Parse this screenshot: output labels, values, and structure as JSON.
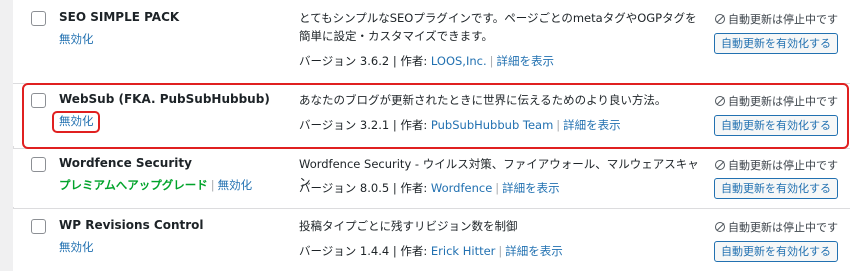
{
  "plugins": [
    {
      "name": "SEO SIMPLE PACK",
      "upgrade_label": "",
      "deactivate_label": "無効化",
      "description": "とてもシンプルなSEOプラグインです。ページごとのmetaタグやOGPタグを簡単に設定・カスタマイズできます。",
      "version_text": "バージョン 3.6.2 | 作者: ",
      "author": "LOOS,Inc.",
      "details_label": "詳細を表示",
      "auto_update_status": "自動更新は停止中です",
      "auto_update_button": "自動更新を有効化する"
    },
    {
      "name": "WebSub (FKA. PubSubHubbub)",
      "upgrade_label": "",
      "deactivate_label": "無効化",
      "description": "あなたのブログが更新されたときに世界に伝えるためのより良い方法。",
      "version_text": "バージョン 3.2.1 | 作者: ",
      "author": "PubSubHubbub Team",
      "details_label": "詳細を表示",
      "auto_update_status": "自動更新は停止中です",
      "auto_update_button": "自動更新を有効化する"
    },
    {
      "name": "Wordfence Security",
      "upgrade_label": "プレミアムへアップグレード",
      "deactivate_label": "無効化",
      "description": "Wordfence Security - ウイルス対策、ファイアウォール、マルウェアスキャン",
      "version_text": "バージョン 8.0.5 | 作者: ",
      "author": "Wordfence",
      "details_label": "詳細を表示",
      "auto_update_status": "自動更新は停止中です",
      "auto_update_button": "自動更新を有効化する"
    },
    {
      "name": "WP Revisions Control",
      "upgrade_label": "",
      "deactivate_label": "無効化",
      "description": "投稿タイプごとに残すリビジョン数を制御",
      "version_text": "バージョン 1.4.4 | 作者: ",
      "author": "Erick Hitter",
      "details_label": "詳細を表示",
      "auto_update_status": "自動更新は停止中です",
      "auto_update_button": "自動更新を有効化する"
    }
  ],
  "colors": {
    "link": "#2271b1",
    "upgrade": "#00a32a",
    "highlight": "#e02020",
    "background": "#f0f0f1"
  }
}
